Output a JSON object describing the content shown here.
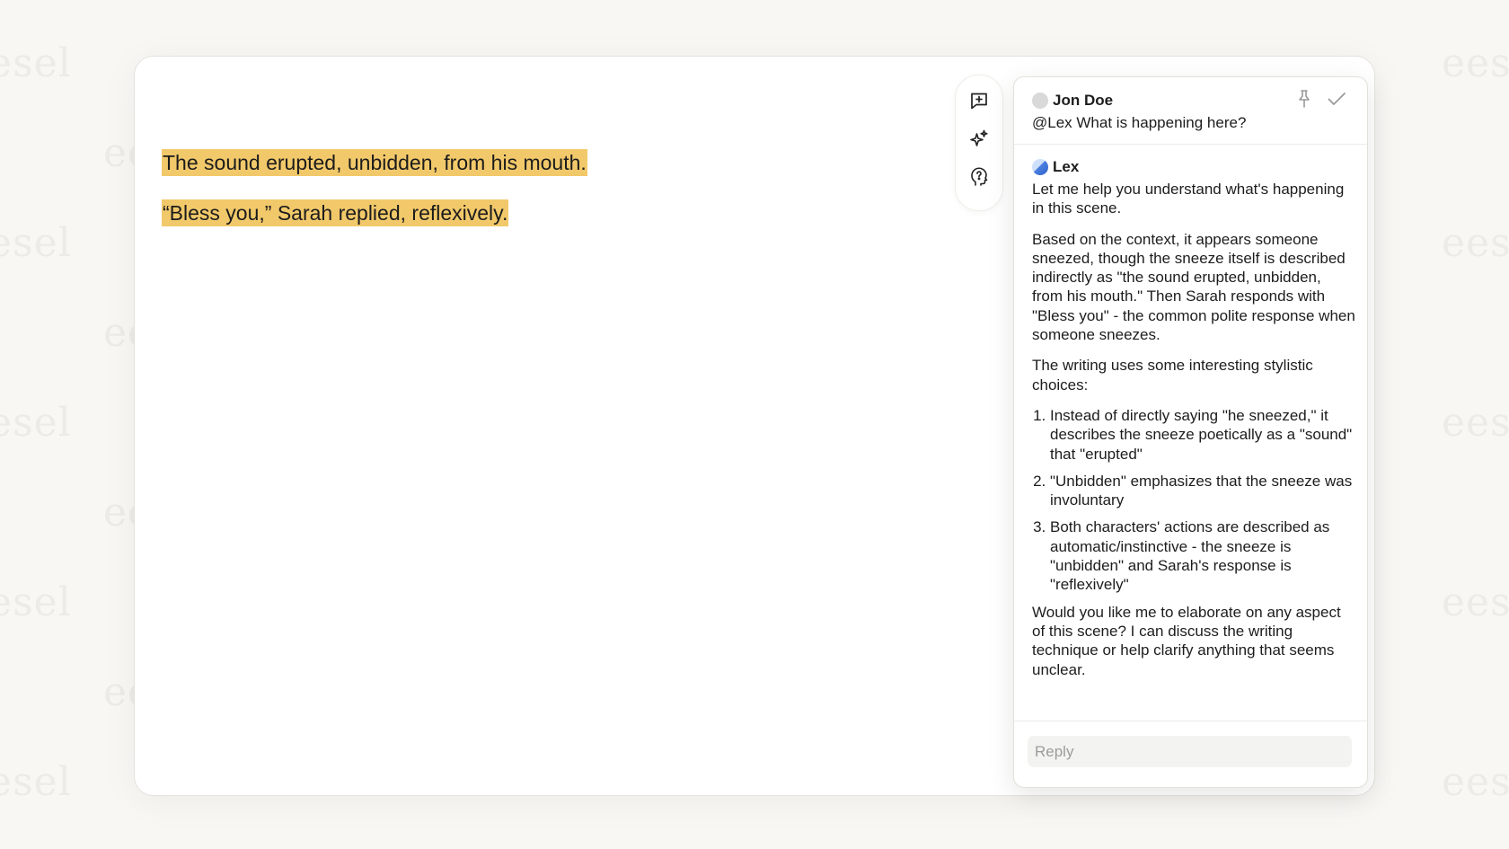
{
  "watermark": "eesel",
  "document": {
    "paragraphs": [
      "The sound erupted, unbidden, from his mouth.",
      "“Bless you,” Sarah replied, reflexively."
    ]
  },
  "toolbar": {
    "icons": [
      "add-comment-icon",
      "sparkles-icon",
      "ask-head-icon"
    ]
  },
  "comment_panel": {
    "header_icons": [
      "pin-icon",
      "resolve-check-icon"
    ],
    "comment": {
      "author": "Jon Doe",
      "text": "@Lex What is happening here?"
    },
    "reply": {
      "author": "Lex",
      "intro": "Let me help you understand what's happening in this scene.",
      "context": "Based on the context, it appears someone sneezed, though the sneeze itself is described indirectly as \"the sound erupted, unbidden, from his mouth.\" Then Sarah responds with \"Bless you\" - the common polite response when someone sneezes.",
      "lead": "The writing uses some interesting stylistic choices:",
      "points": [
        "Instead of directly saying \"he sneezed,\" it describes the sneeze poetically as a \"sound\" that \"erupted\"",
        "\"Unbidden\" emphasizes that the sneeze was involuntary",
        "Both characters' actions are described as automatic/instinctive - the sneeze is \"unbidden\" and Sarah's response is \"reflexively\""
      ],
      "closing": "Would you like me to elaborate on any aspect of this scene? I can discuss the writing technique or help clarify anything that seems unclear."
    },
    "reply_input": {
      "placeholder": "Reply",
      "value": ""
    }
  },
  "colors": {
    "highlight": "#f2c96a",
    "background": "#f8f7f4",
    "watermark": "#ecebe7"
  }
}
